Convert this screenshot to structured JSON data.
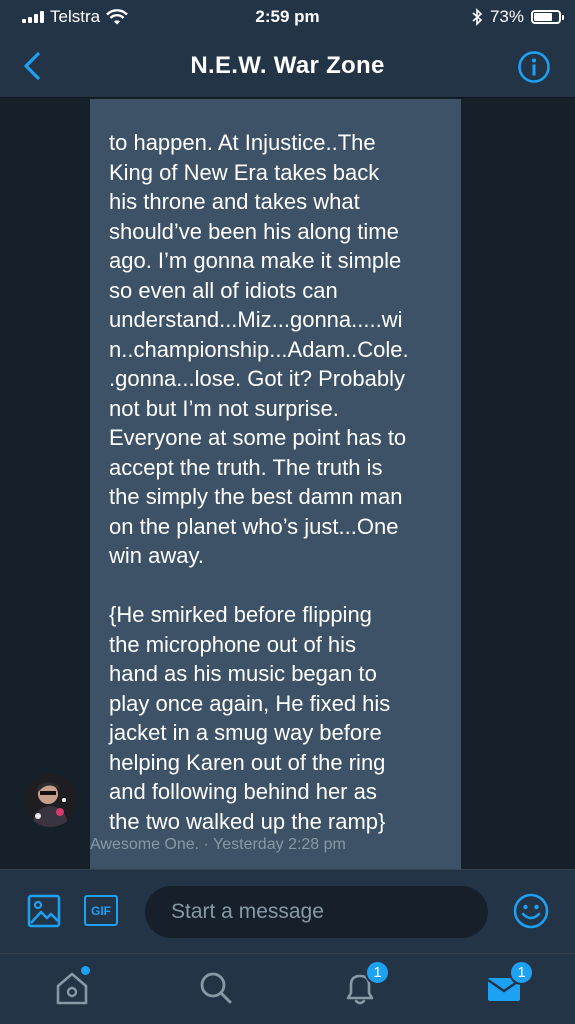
{
  "status_bar": {
    "carrier": "Telstra",
    "time": "2:59 pm",
    "battery_percent": "73%",
    "battery_level": 0.73
  },
  "header": {
    "title": "N.E.W. War Zone",
    "icons": {
      "back": "chevron-left-icon",
      "info": "info-icon"
    }
  },
  "message": {
    "text": "to happen. At Injustice..The\nKing of New Era takes back\nhis throne and takes what\nshould’ve been his along time\nago. I’m gonna make it simple\nso even all of idiots can\nunderstand...Miz...gonna.....wi\nn..championship...Adam..Cole.\n.gonna...lose. Got it? Probably\nnot but I’m not surprise.\nEveryone at some point has to\naccept the truth. The truth is\nthe simply the best damn man\non the planet who’s just...One\nwin away.\n\n{He smirked before flipping\nthe microphone out of his\nhand as his music began to\nplay once again, He fixed his\njacket in a smug way before\nhelping Karen out of the ring\nand following behind her as\nthe two walked up the ramp}",
    "meta": "Awesome One. · Yesterday 2:28 pm"
  },
  "composer": {
    "placeholder": "Start a message",
    "gif_label": "GIF",
    "icons": {
      "media": "image-icon",
      "emoji": "smiley-icon"
    }
  },
  "tabs": {
    "notifications_badge": "1",
    "messages_badge": "1",
    "icons": [
      "home-icon",
      "search-icon",
      "bell-icon",
      "envelope-icon"
    ]
  },
  "colors": {
    "accent": "#1da1f2",
    "background": "#15202b",
    "bar": "#243447",
    "bubble": "#3d5266",
    "muted": "#8899a6"
  }
}
